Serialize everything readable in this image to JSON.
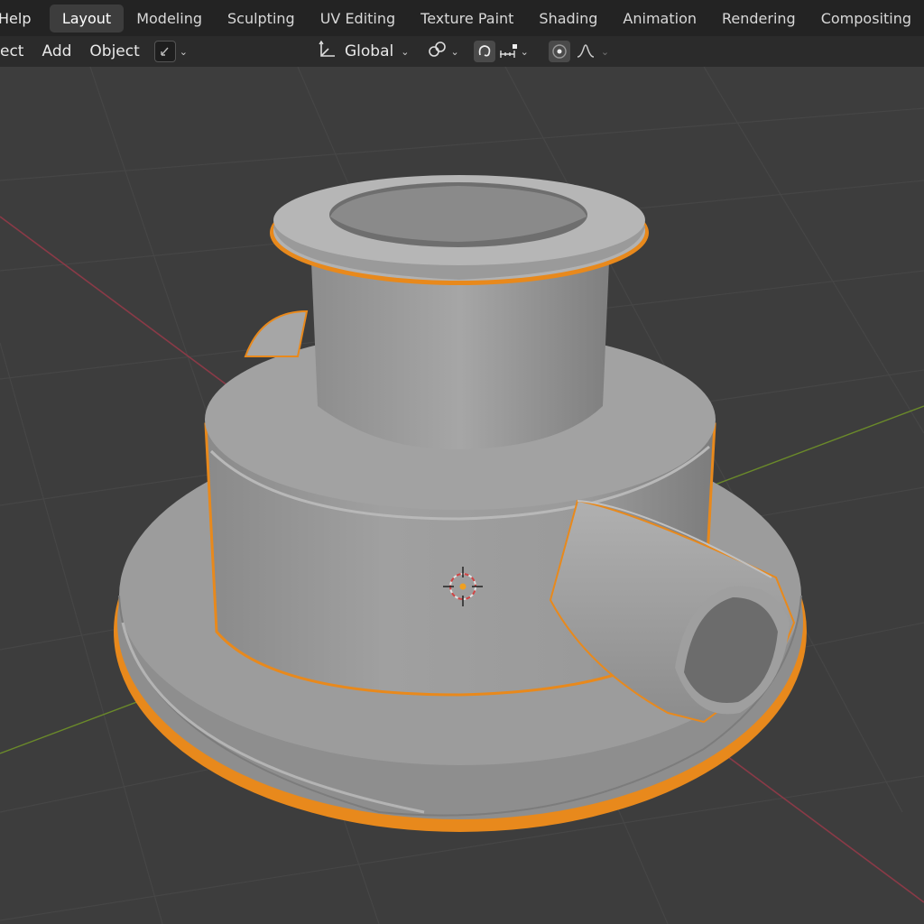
{
  "topbar": {
    "menu_partial": "Help",
    "tabs": [
      {
        "label": "Layout",
        "active": true
      },
      {
        "label": "Modeling"
      },
      {
        "label": "Sculpting"
      },
      {
        "label": "UV Editing"
      },
      {
        "label": "Texture Paint"
      },
      {
        "label": "Shading"
      },
      {
        "label": "Animation"
      },
      {
        "label": "Rendering"
      },
      {
        "label": "Compositing"
      }
    ]
  },
  "header": {
    "menu_partial": "ect",
    "add_label": "Add",
    "object_label": "Object",
    "transform_orientation": "Global",
    "chevron": "⌄"
  },
  "viewport": {
    "background": "#3d3d3d",
    "grid_color": "#464646",
    "x_axis_color": "#8a3a47",
    "y_axis_color": "#6b8a2a",
    "selection_outline": "#e8891c",
    "object_color": "#9a9a9a"
  },
  "icons": [
    "object-mode-icon",
    "transform-pivot-icon",
    "snap-icon",
    "magnet-icon",
    "snap-increment-icon",
    "proportional-edit-icon",
    "falloff-curve-icon",
    "3d-cursor-icon",
    "origin-dot-icon"
  ]
}
